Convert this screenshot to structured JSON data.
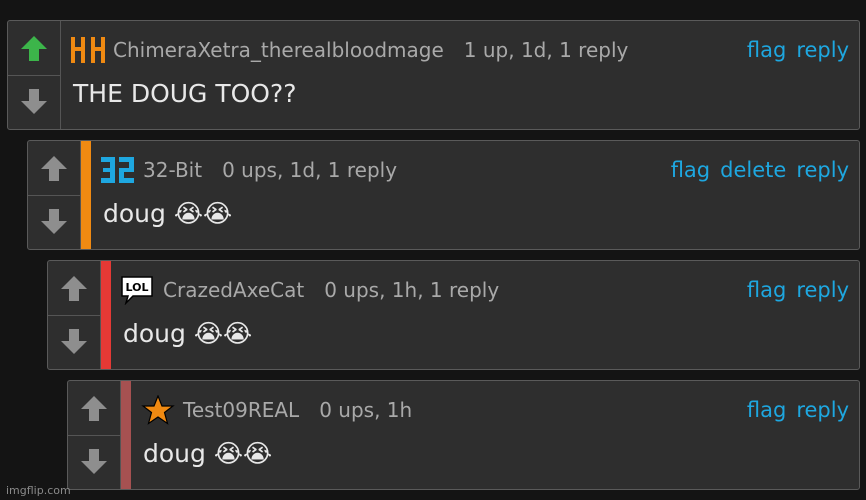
{
  "colors": {
    "background": "#141414",
    "panel": "#2e2e2e",
    "link": "#1ea7e0",
    "upvoted_arrow": "#3cb54a",
    "arrow": "#8e8e8e",
    "thread_stripes": [
      "#f08a12",
      "#e53935",
      "#a65151"
    ]
  },
  "comments": [
    {
      "avatar_icon": "orange-hhh-logo-icon",
      "user": "ChimeraXetra_therealbloodmage",
      "meta": "1 up, 1d, 1 reply",
      "text": "THE DOUG TOO??",
      "actions": [
        "flag",
        "reply"
      ],
      "upvoted": true
    },
    {
      "avatar_icon": "blue-32-logo-icon",
      "user": "32-Bit",
      "meta": "0 ups, 1d, 1 reply",
      "text": "doug 😭😭",
      "actions": [
        "flag",
        "delete",
        "reply"
      ],
      "upvoted": false
    },
    {
      "avatar_icon": "lol-speech-bubble-icon",
      "user": "CrazedAxeCat",
      "meta": "0 ups, 1h, 1 reply",
      "text": "doug 😭😭",
      "actions": [
        "flag",
        "reply"
      ],
      "upvoted": false
    },
    {
      "avatar_icon": "orange-star-icon",
      "avatar_text": "",
      "user": "Test09REAL",
      "meta": "0 ups, 1h",
      "text": "doug 😭😭",
      "actions": [
        "flag",
        "reply"
      ],
      "upvoted": false
    }
  ],
  "avatar_text": {
    "lol": "LOL"
  },
  "watermark": "imgflip.com"
}
